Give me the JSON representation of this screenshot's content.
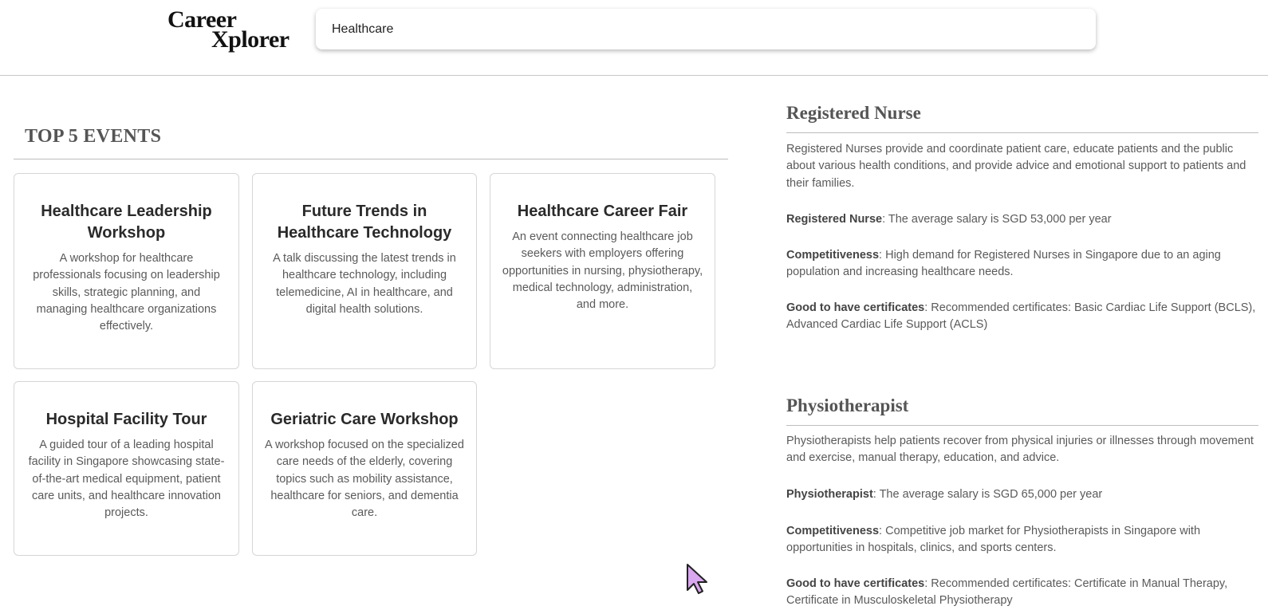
{
  "logo": {
    "line1": "Career",
    "line2": "Xplorer"
  },
  "search": {
    "value": "Healthcare",
    "placeholder": ""
  },
  "events": {
    "title": "TOP 5 EVENTS",
    "items": [
      {
        "title": "Healthcare Leadership Workshop",
        "description": "A workshop for healthcare professionals focusing on leadership skills, strategic planning, and managing healthcare organizations effectively."
      },
      {
        "title": "Future Trends in Healthcare Technology",
        "description": "A talk discussing the latest trends in healthcare technology, including telemedicine, AI in healthcare, and digital health solutions."
      },
      {
        "title": "Healthcare Career Fair",
        "description": "An event connecting healthcare job seekers with employers offering opportunities in nursing, physiotherapy, medical technology, administration, and more."
      },
      {
        "title": "Hospital Facility Tour",
        "description": "A guided tour of a leading hospital facility in Singapore showcasing state-of-the-art medical equipment, patient care units, and healthcare innovation projects."
      },
      {
        "title": "Geriatric Care Workshop",
        "description": "A workshop focused on the specialized care needs of the elderly, covering topics such as mobility assistance, healthcare for seniors, and dementia care."
      }
    ]
  },
  "jobs": [
    {
      "title": "Registered Nurse",
      "description": "Registered Nurses provide and coordinate patient care, educate patients and the public about various health conditions, and provide advice and emotional support to patients and their families.",
      "salary_label": "Registered Nurse",
      "salary_text": ": The average salary is SGD 53,000 per year",
      "competitiveness_label": "Competitiveness",
      "competitiveness_text": ": High demand for Registered Nurses in Singapore due to an aging population and increasing healthcare needs.",
      "certificates_label": "Good to have certificates",
      "certificates_text": ": Recommended certificates: Basic Cardiac Life Support (BCLS), Advanced Cardiac Life Support (ACLS)"
    },
    {
      "title": "Physiotherapist",
      "description": "Physiotherapists help patients recover from physical injuries or illnesses through movement and exercise, manual therapy, education, and advice.",
      "salary_label": "Physiotherapist",
      "salary_text": ": The average salary is SGD 65,000 per year",
      "competitiveness_label": "Competitiveness",
      "competitiveness_text": ": Competitive job market for Physiotherapists in Singapore with opportunities in hospitals, clinics, and sports centers.",
      "certificates_label": "Good to have certificates",
      "certificates_text": ": Recommended certificates: Certificate in Manual Therapy, Certificate in Musculoskeletal Physiotherapy"
    }
  ],
  "icons": {
    "cursor": "mouse-pointer-icon"
  },
  "colors": {
    "cursor_fill": "#d9a6f0",
    "heading": "#555555",
    "body_text": "#5a5a5a"
  }
}
